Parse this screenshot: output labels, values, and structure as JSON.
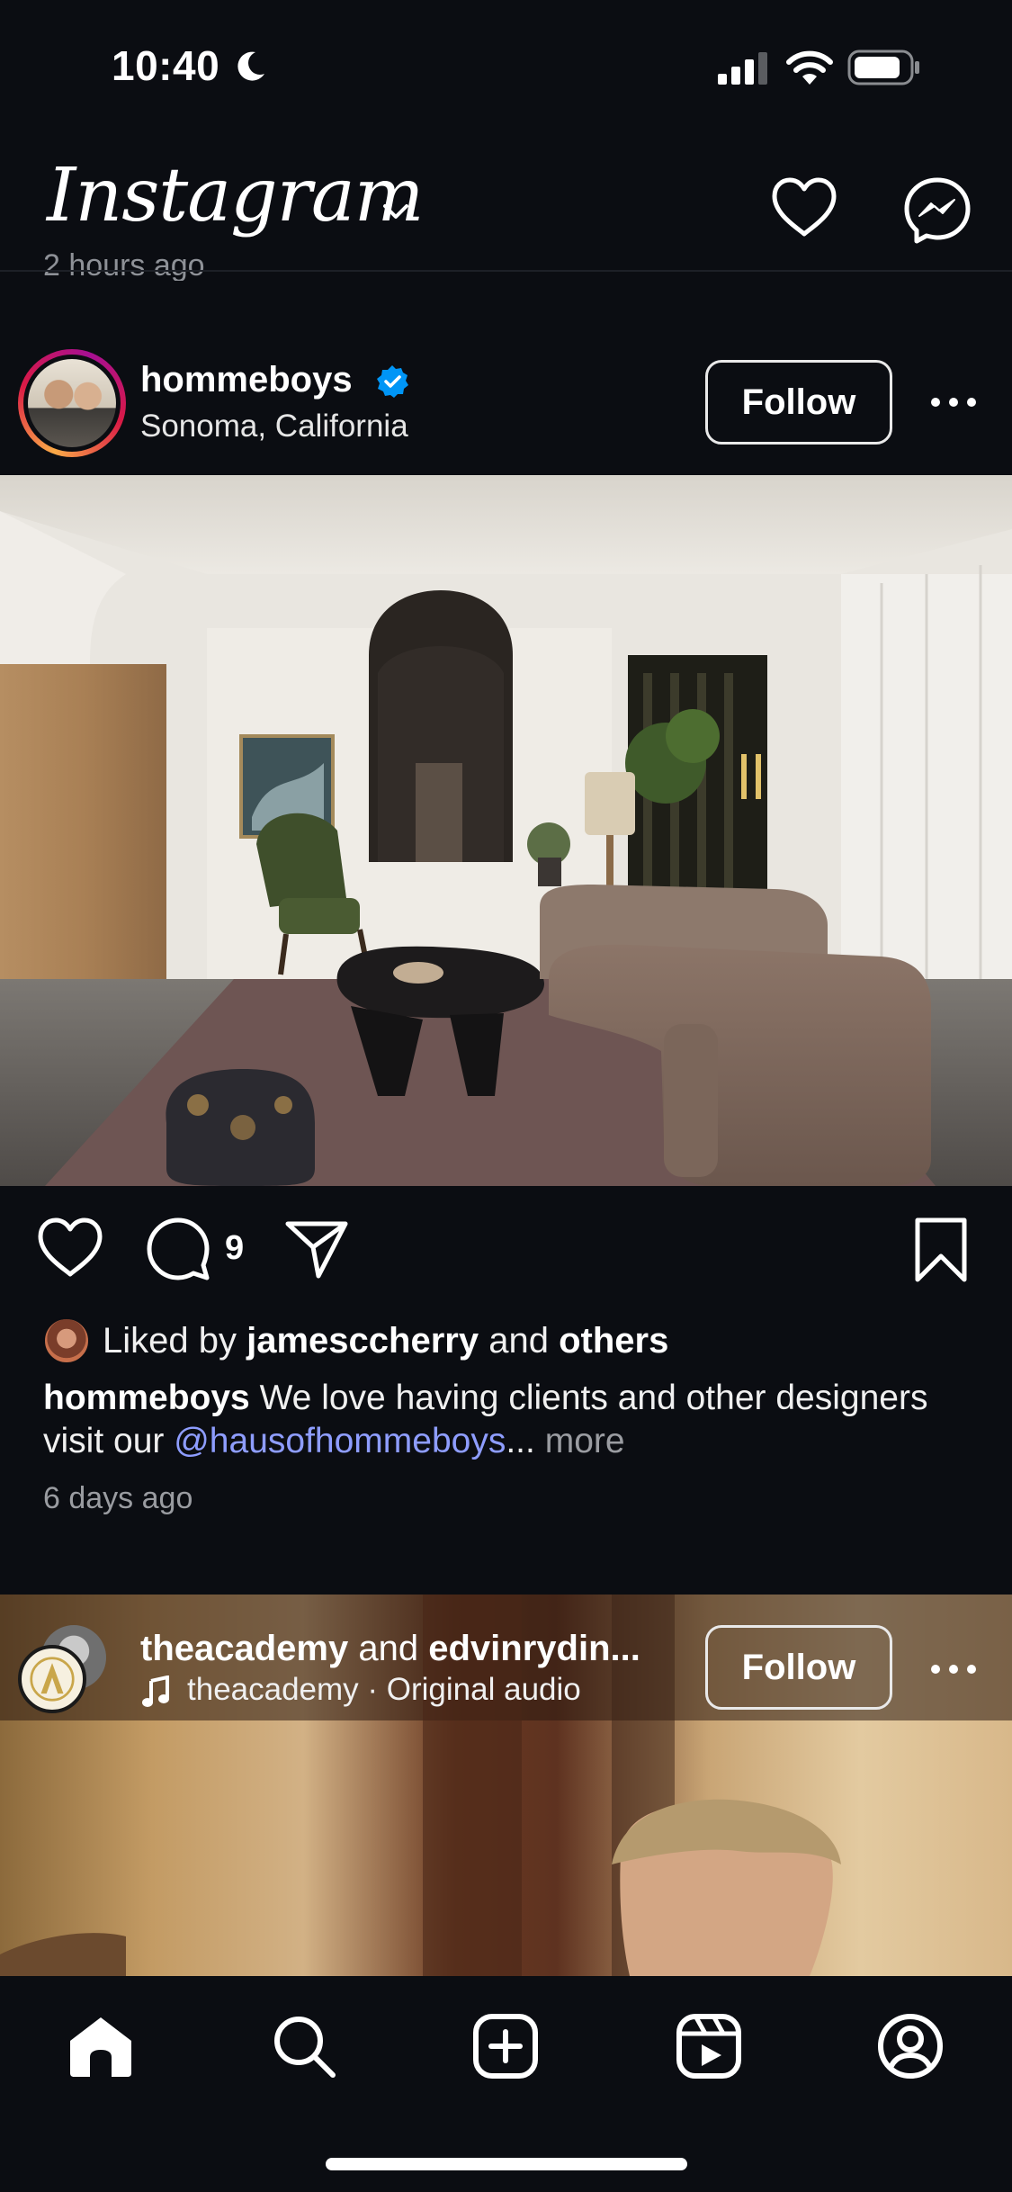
{
  "status_bar": {
    "time": "10:40"
  },
  "header": {
    "logo": "Instagram"
  },
  "previous_post": {
    "time_fragment": "2 hours ago"
  },
  "post1": {
    "username": "hommeboys",
    "location": "Sonoma, California",
    "follow_label": "Follow",
    "comment_count": "9",
    "likes": {
      "prefix": "Liked by",
      "user": "jamesccherry",
      "joiner": "and",
      "others": "others"
    },
    "caption": {
      "username": "hommeboys",
      "text": "We love having clients and other designers visit our",
      "mention": "@hausofhommeboys",
      "ellipsis": "...",
      "more": "more"
    },
    "time": "6 days ago"
  },
  "post2": {
    "user1": "theacademy",
    "joiner": "and",
    "user2": "edvinrydin...",
    "audio": "theacademy · Original audio",
    "follow_label": "Follow"
  },
  "colors": {
    "background": "#0b0d12",
    "mention": "#8e9dff",
    "verified": "#0095f6"
  }
}
